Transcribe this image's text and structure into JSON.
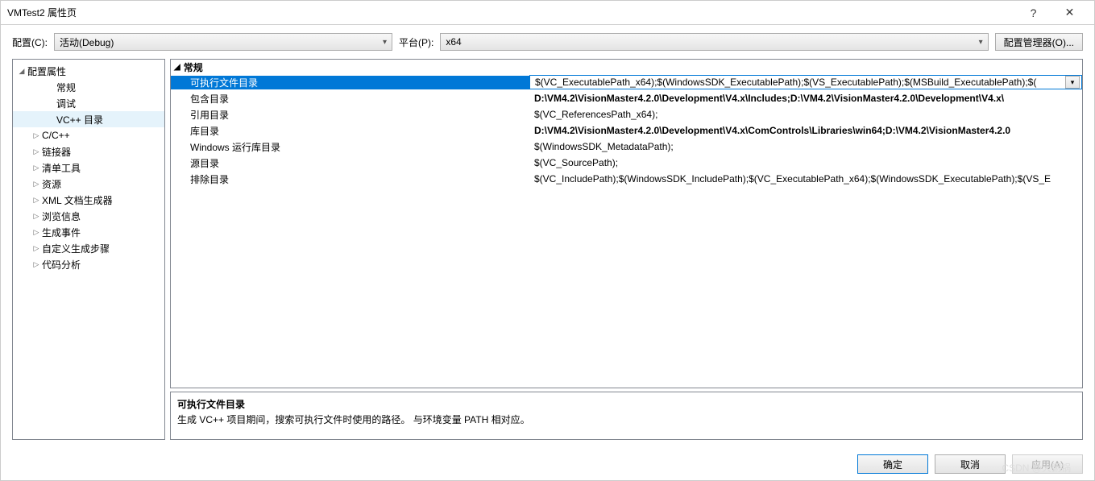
{
  "window": {
    "title": "VMTest2 属性页"
  },
  "titlebar": {
    "help": "?",
    "close": "✕"
  },
  "toolbar": {
    "config_label": "配置(C):",
    "config_value": "活动(Debug)",
    "platform_label": "平台(P):",
    "platform_value": "x64",
    "manager_btn": "配置管理器(O)..."
  },
  "tree": {
    "root": "配置属性",
    "items": [
      {
        "label": "常规",
        "indent": 2,
        "exp": ""
      },
      {
        "label": "调试",
        "indent": 2,
        "exp": ""
      },
      {
        "label": "VC++ 目录",
        "indent": 2,
        "exp": "",
        "selected": true
      },
      {
        "label": "C/C++",
        "indent": 1,
        "exp": "▷"
      },
      {
        "label": "链接器",
        "indent": 1,
        "exp": "▷"
      },
      {
        "label": "清单工具",
        "indent": 1,
        "exp": "▷"
      },
      {
        "label": "资源",
        "indent": 1,
        "exp": "▷"
      },
      {
        "label": "XML 文档生成器",
        "indent": 1,
        "exp": "▷"
      },
      {
        "label": "浏览信息",
        "indent": 1,
        "exp": "▷"
      },
      {
        "label": "生成事件",
        "indent": 1,
        "exp": "▷"
      },
      {
        "label": "自定义生成步骤",
        "indent": 1,
        "exp": "▷"
      },
      {
        "label": "代码分析",
        "indent": 1,
        "exp": "▷"
      }
    ]
  },
  "grid": {
    "section": "常规",
    "rows": [
      {
        "name": "可执行文件目录",
        "value": "$(VC_ExecutablePath_x64);$(WindowsSDK_ExecutablePath);$(VS_ExecutablePath);$(MSBuild_ExecutablePath);$(",
        "selected": true,
        "dropdown": true
      },
      {
        "name": "包含目录",
        "value": "D:\\VM4.2\\VisionMaster4.2.0\\Development\\V4.x\\Includes;D:\\VM4.2\\VisionMaster4.2.0\\Development\\V4.x\\",
        "bold": true
      },
      {
        "name": "引用目录",
        "value": "$(VC_ReferencesPath_x64);"
      },
      {
        "name": "库目录",
        "value": "D:\\VM4.2\\VisionMaster4.2.0\\Development\\V4.x\\ComControls\\Libraries\\win64;D:\\VM4.2\\VisionMaster4.2.0",
        "bold": true
      },
      {
        "name": "Windows 运行库目录",
        "value": "$(WindowsSDK_MetadataPath);"
      },
      {
        "name": "源目录",
        "value": "$(VC_SourcePath);"
      },
      {
        "name": "排除目录",
        "value": "$(VC_IncludePath);$(WindowsSDK_IncludePath);$(VC_ExecutablePath_x64);$(WindowsSDK_ExecutablePath);$(VS_E"
      }
    ]
  },
  "description": {
    "title": "可执行文件目录",
    "text": "生成 VC++ 项目期间，搜索可执行文件时使用的路径。  与环境变量 PATH 相对应。"
  },
  "footer": {
    "ok": "确定",
    "cancel": "取消",
    "apply": "应用(A)"
  },
  "watermark": "CSDN @大粥锅"
}
